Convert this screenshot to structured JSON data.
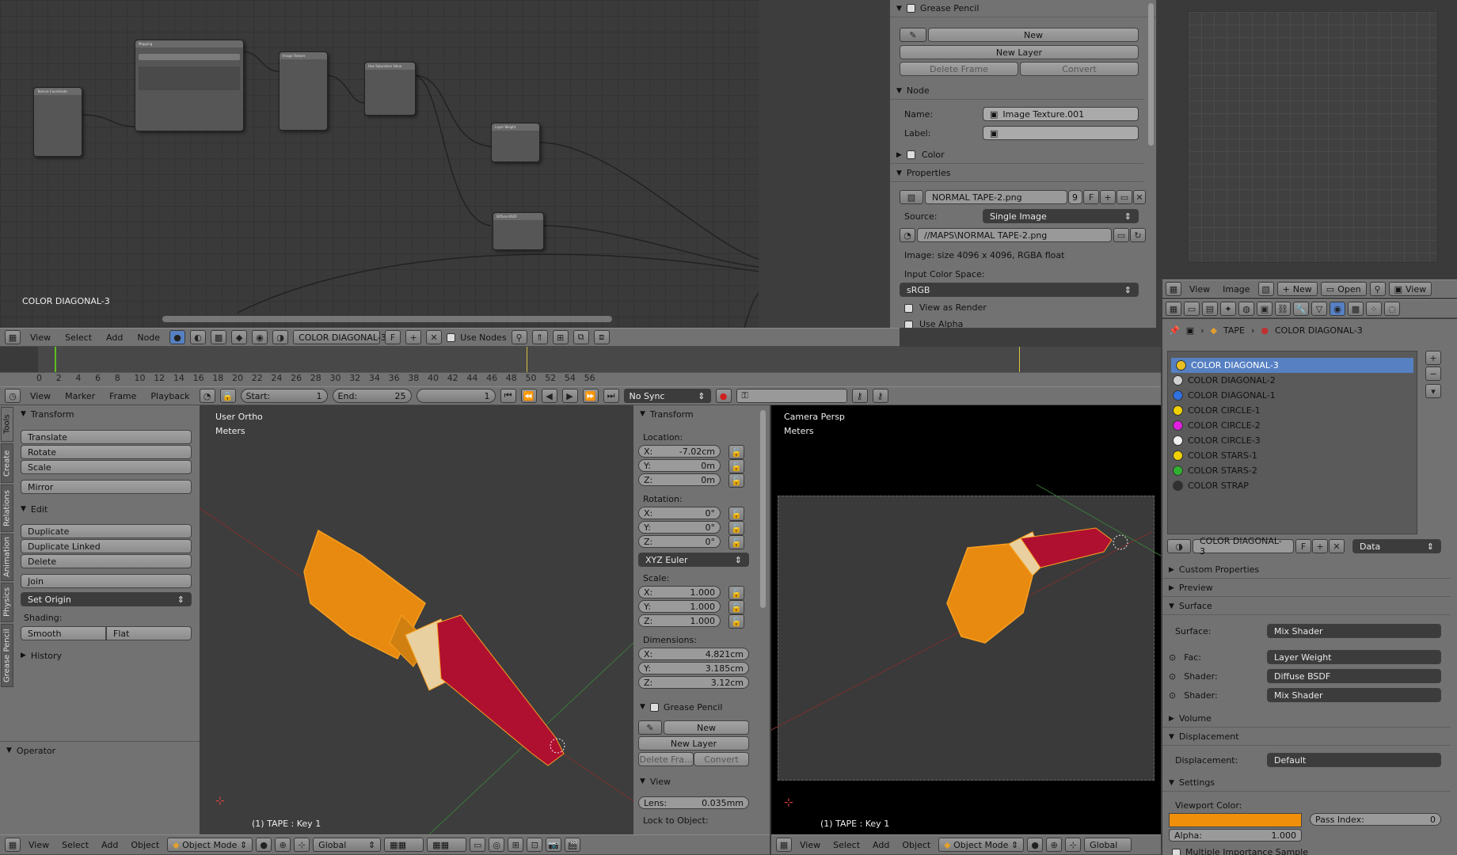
{
  "node_editor": {
    "material_label": "COLOR DIAGONAL-3",
    "header": {
      "menus": [
        "View",
        "Select",
        "Add",
        "Node"
      ],
      "material_name": "COLOR DIAGONAL-3",
      "fake_user": "F",
      "use_nodes_label": "Use Nodes"
    }
  },
  "node_props": {
    "grease_pencil": {
      "title": "Grease Pencil",
      "new": "New",
      "new_layer": "New Layer",
      "delete_frame": "Delete Frame",
      "convert": "Convert"
    },
    "node": {
      "title": "Node",
      "name_label": "Name:",
      "name_value": "Image Texture.001",
      "label_label": "Label:",
      "label_value": ""
    },
    "color_title": "Color",
    "properties": {
      "title": "Properties",
      "image_name": "NORMAL TAPE-2.png",
      "users": "9",
      "fake": "F",
      "source_label": "Source:",
      "source_value": "Single Image",
      "path": "//MAPS\\NORMAL TAPE-2.png",
      "info": "Image: size 4096 x 4096, RGBA float",
      "input_cs_label": "Input Color Space:",
      "input_cs_value": "sRGB",
      "view_as_render": "View as Render",
      "use_alpha": "Use Alpha"
    }
  },
  "image_editor": {
    "header": {
      "view": "View",
      "image": "Image",
      "new": "New",
      "open": "Open",
      "view2": "View"
    }
  },
  "material_panel": {
    "breadcrumb": {
      "object": "TAPE",
      "material": "COLOR DIAGONAL-3"
    },
    "materials": [
      {
        "name": "COLOR DIAGONAL-3",
        "color": "#e8c020"
      },
      {
        "name": "COLOR DIAGONAL-2",
        "color": "#d0d0d0"
      },
      {
        "name": "COLOR DIAGONAL-1",
        "color": "#3070e0"
      },
      {
        "name": "COLOR CIRCLE-1",
        "color": "#f0d000"
      },
      {
        "name": "COLOR CIRCLE-2",
        "color": "#e020e0"
      },
      {
        "name": "COLOR CIRCLE-3",
        "color": "#f0f0f0"
      },
      {
        "name": "COLOR STARS-1",
        "color": "#f0d000"
      },
      {
        "name": "COLOR STARS-2",
        "color": "#30b030"
      },
      {
        "name": "COLOR STRAP",
        "color": "#303030"
      }
    ],
    "slot_name": "COLOR DIAGONAL-3",
    "slot_fake": "F",
    "link": "Data",
    "custom_props": "Custom Properties",
    "preview": "Preview",
    "surface_title": "Surface",
    "surface_label": "Surface:",
    "surface_value": "Mix Shader",
    "fac_label": "Fac:",
    "fac_value": "Layer Weight",
    "shader1_label": "Shader:",
    "shader1_value": "Diffuse BSDF",
    "shader2_label": "Shader:",
    "shader2_value": "Mix Shader",
    "volume": "Volume",
    "displacement_title": "Displacement",
    "displacement_label": "Displacement:",
    "displacement_value": "Default",
    "settings_title": "Settings",
    "viewport_color_label": "Viewport Color:",
    "viewport_color": "#f0900a",
    "alpha_label": "Alpha:",
    "alpha_value": "1.000",
    "pass_index_label": "Pass Index:",
    "pass_index_value": "0",
    "mis": "Multiple Importance Sample"
  },
  "timeline": {
    "ticks": [
      "0",
      "2",
      "4",
      "6",
      "8",
      "10",
      "12",
      "14",
      "16",
      "18",
      "20",
      "22",
      "24",
      "26",
      "28",
      "30",
      "32",
      "34",
      "36",
      "38",
      "40",
      "42",
      "44",
      "46",
      "48",
      "50",
      "52",
      "54",
      "56"
    ],
    "header": {
      "menus": [
        "View",
        "Marker",
        "Frame",
        "Playback"
      ],
      "start_label": "Start:",
      "start": "1",
      "end_label": "End:",
      "end": "25",
      "current": "1",
      "sync": "No Sync"
    }
  },
  "tools": {
    "tabs": [
      "Tools",
      "Create",
      "Relations",
      "Animation",
      "Physics",
      "Grease Pencil"
    ],
    "transform": "Transform",
    "translate": "Translate",
    "rotate": "Rotate",
    "scale": "Scale",
    "mirror": "Mirror",
    "edit": "Edit",
    "duplicate": "Duplicate",
    "duplicate_linked": "Duplicate Linked",
    "delete": "Delete",
    "join": "Join",
    "set_origin": "Set Origin",
    "shading": "Shading:",
    "smooth": "Smooth",
    "flat": "Flat",
    "history": "History",
    "operator": "Operator"
  },
  "viewport_left": {
    "view_name": "User Ortho",
    "units": "Meters",
    "status": "(1) TAPE : Key 1"
  },
  "n_panel": {
    "transform": "Transform",
    "location": "Location:",
    "loc": [
      {
        "axis": "X:",
        "val": "-7.02cm"
      },
      {
        "axis": "Y:",
        "val": "0m"
      },
      {
        "axis": "Z:",
        "val": "0m"
      }
    ],
    "rotation": "Rotation:",
    "rot": [
      {
        "axis": "X:",
        "val": "0°"
      },
      {
        "axis": "Y:",
        "val": "0°"
      },
      {
        "axis": "Z:",
        "val": "0°"
      }
    ],
    "rot_mode": "XYZ Euler",
    "scale": "Scale:",
    "scl": [
      {
        "axis": "X:",
        "val": "1.000"
      },
      {
        "axis": "Y:",
        "val": "1.000"
      },
      {
        "axis": "Z:",
        "val": "1.000"
      }
    ],
    "dimensions": "Dimensions:",
    "dim": [
      {
        "axis": "X:",
        "val": "4.821cm"
      },
      {
        "axis": "Y:",
        "val": "3.185cm"
      },
      {
        "axis": "Z:",
        "val": "3.12cm"
      }
    ],
    "gp": "Grease Pencil",
    "gp_new": "New",
    "gp_new_layer": "New Layer",
    "gp_delete": "Delete Fra...",
    "gp_convert": "Convert",
    "view": "View",
    "lens_label": "Lens:",
    "lens": "0.035mm",
    "lock": "Lock to Object:"
  },
  "viewport_right": {
    "view_name": "Camera Persp",
    "units": "Meters",
    "status": "(1) TAPE : Key 1"
  },
  "bottom_header": {
    "menus": [
      "View",
      "Select",
      "Add",
      "Object"
    ],
    "mode": "Object Mode",
    "orientation": "Global"
  },
  "bottom_header_right": {
    "menus": [
      "View",
      "Select",
      "Add",
      "Object"
    ],
    "mode": "Object Mode",
    "orientation": "Global"
  }
}
